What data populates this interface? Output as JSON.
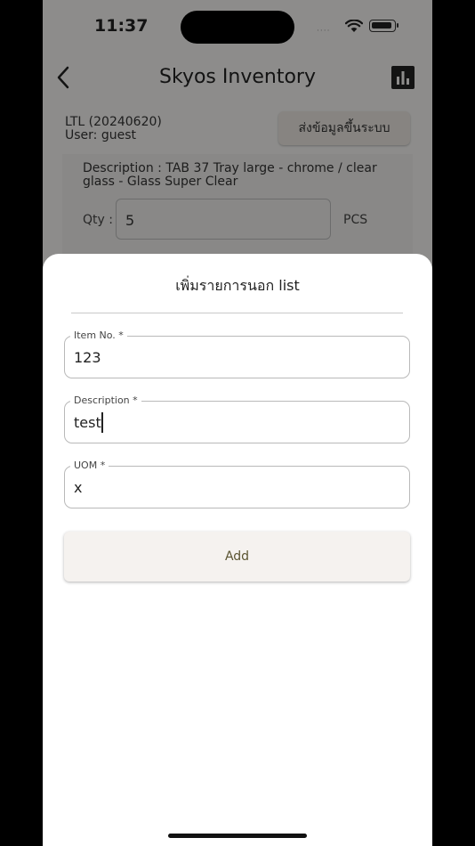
{
  "status_bar": {
    "time": "11:37",
    "signal_dots": "····"
  },
  "app_bar": {
    "title": "Skyos Inventory"
  },
  "session": {
    "line1": "LTL (20240620)",
    "line2": "User: guest",
    "upload_label": "ส่งข้อมูลขึ้นระบบ"
  },
  "item_card": {
    "description": "Description : TAB 37 Tray large - chrome / clear glass - Glass Super Clear",
    "qty_label": "Qty :",
    "qty_value": "5",
    "uom": "PCS"
  },
  "dialog": {
    "title": "เพิ่มรายการนอก list",
    "fields": [
      {
        "label": "Item No. *",
        "value": "123"
      },
      {
        "label": "Description *",
        "value": "test"
      },
      {
        "label": "UOM *",
        "value": "x"
      }
    ],
    "add_label": "Add"
  },
  "colors": {
    "accent_text": "#5a5431",
    "scrim": "rgba(0,0,0,0.42)"
  }
}
